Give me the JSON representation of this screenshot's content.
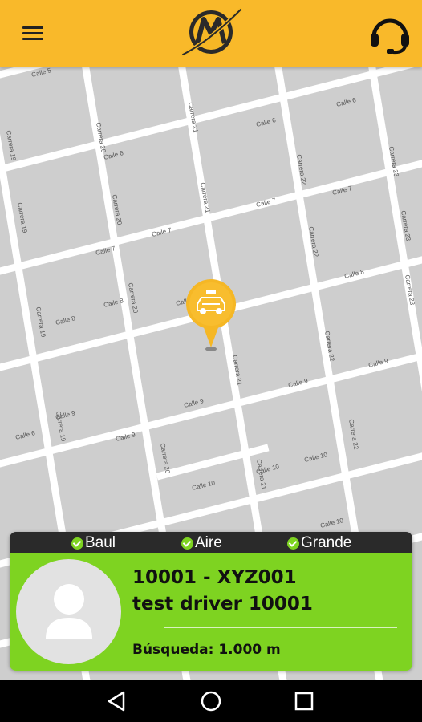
{
  "app": {
    "brand_color": "#f9b92a",
    "accent_color": "#7ed321"
  },
  "topbar": {
    "menu_icon": "hamburger-menu-icon",
    "logo": "app-logo",
    "support_icon": "headset-icon"
  },
  "map": {
    "streets": {
      "calle": [
        "Calle 5",
        "Calle 6",
        "Calle 6",
        "Calle 6",
        "Calle 6",
        "Calle 7",
        "Calle 7",
        "Calle 7",
        "Calle 7",
        "Calle 8",
        "Calle 8",
        "Calle 8",
        "Calle 8",
        "Calle 9",
        "Calle 9",
        "Calle 9",
        "Calle 9",
        "Calle 9",
        "Calle 10",
        "Calle 10",
        "Calle 10",
        "Calle 10",
        "Calle 10"
      ],
      "carrera": [
        "Carrera 19",
        "Carrera 19",
        "Carrera 19",
        "Carrera 19",
        "Carrera 20",
        "Carrera 20",
        "Carrera 20",
        "Carrera 20",
        "Carrera 21",
        "Carrera 21",
        "Carrera 21",
        "Carrera 21",
        "Carrera 22",
        "Carrera 22",
        "Carrera 22",
        "Carrera 22",
        "Carrera 23",
        "Carrera 23",
        "Carrera 23"
      ]
    },
    "marker_icon": "taxi-icon"
  },
  "driver_card": {
    "features": [
      {
        "label": "Baul"
      },
      {
        "label": "Aire"
      },
      {
        "label": "Grande"
      }
    ],
    "avatar_icon": "user-placeholder-icon",
    "id_plate": "10001 - XYZ001",
    "name": "test driver 10001",
    "search_radius": "Búsqueda: 1.000 m"
  },
  "navbar": {
    "back_icon": "back-triangle-icon",
    "home_icon": "home-circle-icon",
    "recents_icon": "recents-square-icon"
  }
}
